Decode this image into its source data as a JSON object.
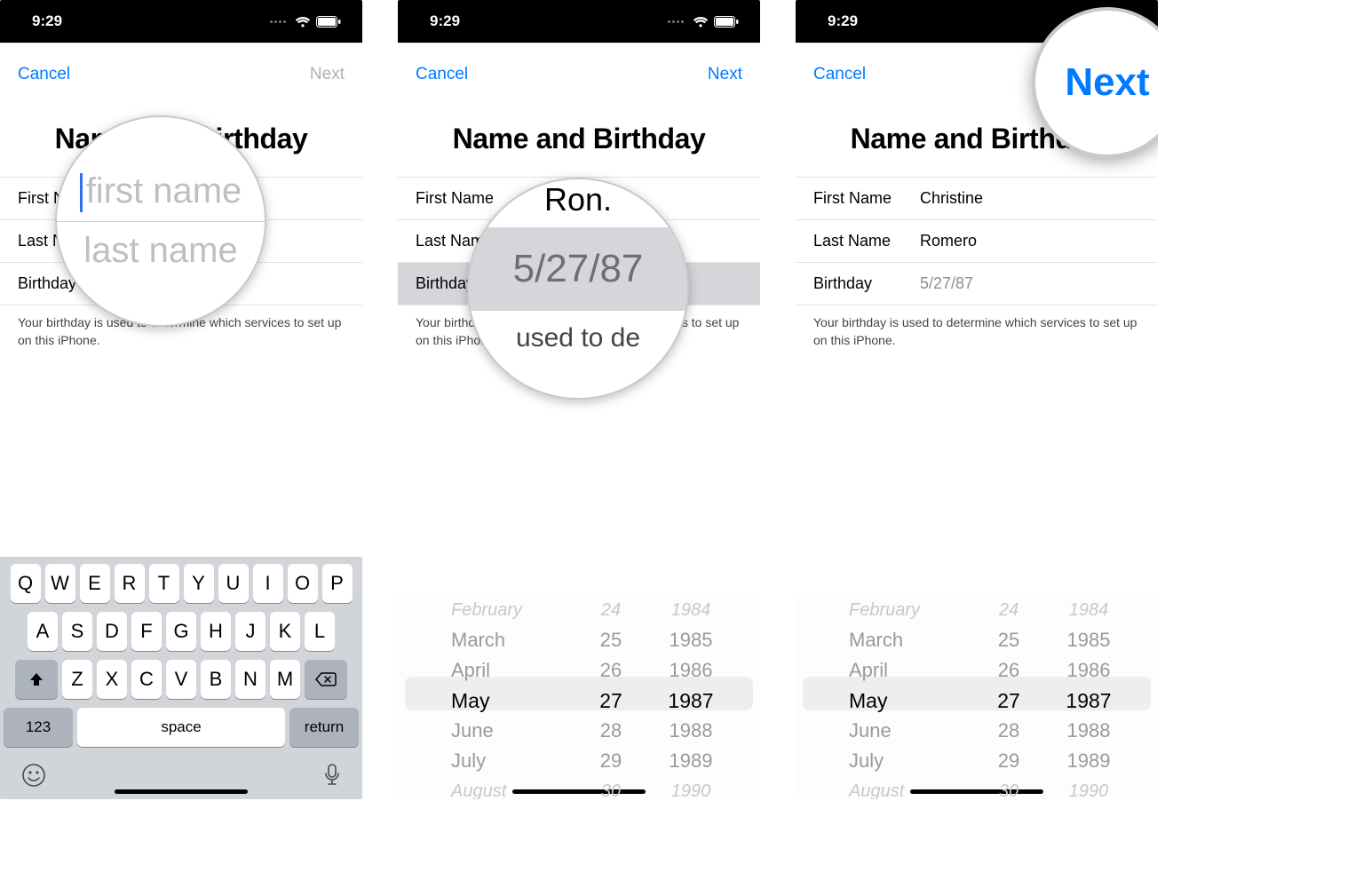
{
  "status": {
    "time": "9:29"
  },
  "nav": {
    "cancel": "Cancel",
    "next": "Next"
  },
  "title": "Name and Birthday",
  "labels": {
    "first": "First Name",
    "last": "Last Name",
    "birthday": "Birthday"
  },
  "footnote": "Your birthday is used to determine which services to set up on this iPhone.",
  "keyboard": {
    "row1": [
      "Q",
      "W",
      "E",
      "R",
      "T",
      "Y",
      "U",
      "I",
      "O",
      "P"
    ],
    "row2": [
      "A",
      "S",
      "D",
      "F",
      "G",
      "H",
      "J",
      "K",
      "L"
    ],
    "row3": [
      "Z",
      "X",
      "C",
      "V",
      "B",
      "N",
      "M"
    ],
    "num": "123",
    "space": "space",
    "return": "return"
  },
  "picker": {
    "months": [
      "February",
      "March",
      "April",
      "May",
      "June",
      "July",
      "August"
    ],
    "days": [
      "24",
      "25",
      "26",
      "27",
      "28",
      "29",
      "30"
    ],
    "years": [
      "1984",
      "1985",
      "1986",
      "1987",
      "1988",
      "1989",
      "1990"
    ],
    "selectedIndex": 3
  },
  "screen1": {
    "callout_first": "first name",
    "callout_last": "last name"
  },
  "screen2": {
    "first_value_partial": "Ron.",
    "callout_date": "5/27/87",
    "callout_foot": "used to de"
  },
  "screen3": {
    "first_value": "Christine",
    "last_value": "Romero",
    "birthday_value": "5/27/87"
  }
}
